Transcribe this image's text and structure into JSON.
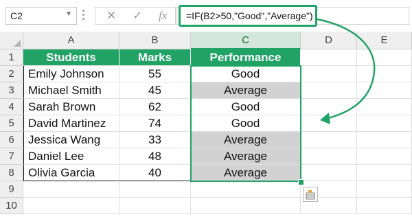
{
  "name_box": {
    "value": "C2",
    "dropdown_icon": "chevron-down-icon"
  },
  "formula_bar": {
    "cancel_icon": "close-icon",
    "enter_icon": "check-icon",
    "fx_label": "fx",
    "formula": "=IF(B2>50,\"Good\",\"Average\")",
    "highlight_color": "#21A366"
  },
  "columns": [
    "A",
    "B",
    "C",
    "D",
    "E"
  ],
  "rows": [
    "1",
    "2",
    "3",
    "4",
    "5",
    "6",
    "7",
    "8",
    "9",
    "10"
  ],
  "table": {
    "headers": [
      "Students",
      "Marks",
      "Performance"
    ],
    "header_color": "#21A366",
    "rows": [
      {
        "student": "Emily Johnson",
        "marks": "55",
        "performance": "Good"
      },
      {
        "student": "Michael Smith",
        "marks": "45",
        "performance": "Average"
      },
      {
        "student": "Sarah Brown",
        "marks": "62",
        "performance": "Good"
      },
      {
        "student": "David Martinez",
        "marks": "74",
        "performance": "Good"
      },
      {
        "student": "Jessica Wang",
        "marks": "33",
        "performance": "Average"
      },
      {
        "student": "Daniel Lee",
        "marks": "48",
        "performance": "Average"
      },
      {
        "student": "Olivia Garcia",
        "marks": "40",
        "performance": "Average"
      }
    ],
    "average_fill_color": "#D2D2D2"
  },
  "selected_cell": "C2",
  "annotation_arrow_color": "#21A366",
  "quick_analysis_icon": "quick-analysis-icon"
}
